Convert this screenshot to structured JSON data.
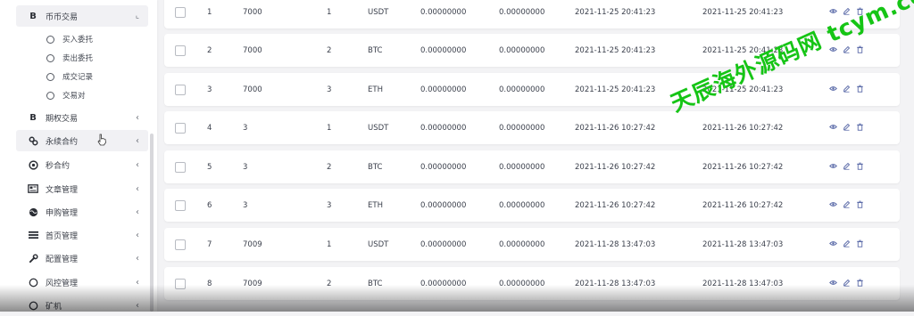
{
  "sidebar": {
    "top_group": {
      "label": "币币交易",
      "icon": "bitcoin-icon",
      "chevron": "⌞"
    },
    "sub_items": [
      {
        "label": "买入委托"
      },
      {
        "label": "卖出委托"
      },
      {
        "label": "成交记录"
      },
      {
        "label": "交易对"
      }
    ],
    "groups": [
      {
        "label": "期权交易",
        "icon": "bitcoin-icon"
      },
      {
        "label": "永续合约",
        "icon": "link-icon"
      },
      {
        "label": "秒合约",
        "icon": "target-icon"
      },
      {
        "label": "文章管理",
        "icon": "newspaper-icon"
      },
      {
        "label": "申购管理",
        "icon": "globe-icon"
      },
      {
        "label": "首页管理",
        "icon": "list-icon"
      },
      {
        "label": "配置管理",
        "icon": "wrench-icon"
      },
      {
        "label": "风控管理",
        "icon": "circle-icon"
      },
      {
        "label": "矿机",
        "icon": "circle-icon"
      }
    ],
    "chevron": "‹"
  },
  "table": {
    "rows": [
      {
        "id": "1",
        "user": "7000",
        "coin_id": "1",
        "coin": "USDT",
        "amount": "0.00000000",
        "frozen": "0.00000000",
        "created": "2021-11-25 20:41:23",
        "updated": "2021-11-25 20:41:23"
      },
      {
        "id": "2",
        "user": "7000",
        "coin_id": "2",
        "coin": "BTC",
        "amount": "0.00000000",
        "frozen": "0.00000000",
        "created": "2021-11-25 20:41:23",
        "updated": "2021-11-25 20:41:23"
      },
      {
        "id": "3",
        "user": "7000",
        "coin_id": "3",
        "coin": "ETH",
        "amount": "0.00000000",
        "frozen": "0.00000000",
        "created": "2021-11-25 20:41:23",
        "updated": "2021-11-25 20:41:23"
      },
      {
        "id": "4",
        "user": "3",
        "coin_id": "1",
        "coin": "USDT",
        "amount": "0.00000000",
        "frozen": "0.00000000",
        "created": "2021-11-26 10:27:42",
        "updated": "2021-11-26 10:27:42"
      },
      {
        "id": "5",
        "user": "3",
        "coin_id": "2",
        "coin": "BTC",
        "amount": "0.00000000",
        "frozen": "0.00000000",
        "created": "2021-11-26 10:27:42",
        "updated": "2021-11-26 10:27:42"
      },
      {
        "id": "6",
        "user": "3",
        "coin_id": "3",
        "coin": "ETH",
        "amount": "0.00000000",
        "frozen": "0.00000000",
        "created": "2021-11-26 10:27:42",
        "updated": "2021-11-26 10:27:42"
      },
      {
        "id": "7",
        "user": "7009",
        "coin_id": "1",
        "coin": "USDT",
        "amount": "0.00000000",
        "frozen": "0.00000000",
        "created": "2021-11-28 13:47:03",
        "updated": "2021-11-28 13:47:03"
      },
      {
        "id": "8",
        "user": "7009",
        "coin_id": "2",
        "coin": "BTC",
        "amount": "0.00000000",
        "frozen": "0.00000000",
        "created": "2021-11-28 13:47:03",
        "updated": "2021-11-28 13:47:03"
      }
    ],
    "actions": [
      "eye-icon",
      "edit-icon",
      "trash-icon"
    ]
  },
  "watermark": "天辰海外源码网 tcym.cc",
  "colors": {
    "accent": "#5a6aa8",
    "watermark": "#15c515"
  }
}
